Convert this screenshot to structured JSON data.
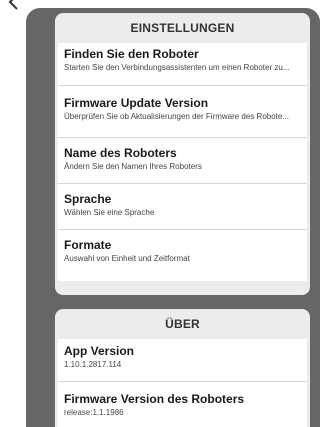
{
  "settings": {
    "header": "EINSTELLUNGEN",
    "items": [
      {
        "title": "Finden Sie den Roboter",
        "subtitle": "Starten Sie den Verbindungsassistenten um einen Roboter zu..."
      },
      {
        "title": "Firmware Update Version",
        "subtitle": "Überprüfen Sie ob Aktualisierungen der Firmware des Robote..."
      },
      {
        "title": "Name des Roboters",
        "subtitle": "Ändern Sie den Namen Ihres Roboters"
      },
      {
        "title": "Sprache",
        "subtitle": "Wählen Sie eine Sprache"
      },
      {
        "title": "Formate",
        "subtitle": "Auswahl von Einheit und Zeitformat"
      }
    ]
  },
  "about": {
    "header": "ÜBER",
    "items": [
      {
        "title": "App Version",
        "subtitle": "1.10.1.2817.114"
      },
      {
        "title": "Firmware Version des Roboters",
        "subtitle": "release:1.1.1986"
      }
    ]
  },
  "icons": {
    "back": "chevron-left-icon"
  },
  "colors": {
    "background": "#666666",
    "panel": "#ececec",
    "item": "#ffffff"
  }
}
